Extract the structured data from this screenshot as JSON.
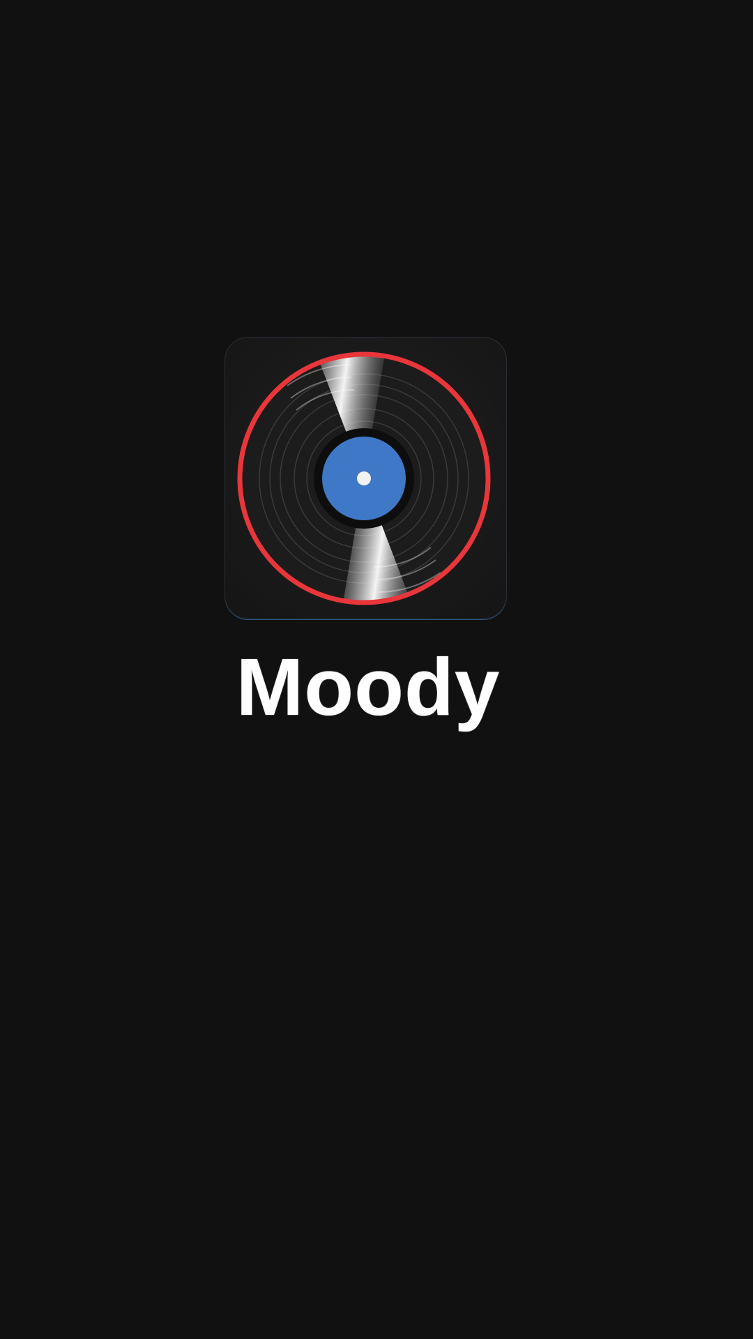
{
  "splash": {
    "app_name": "Moody"
  },
  "icon": {
    "name": "vinyl-record-icon",
    "ring_color": "#e8363a",
    "label_color": "#3f78c6",
    "disc_color": "#1c1c1c",
    "background_color": "#111111"
  }
}
